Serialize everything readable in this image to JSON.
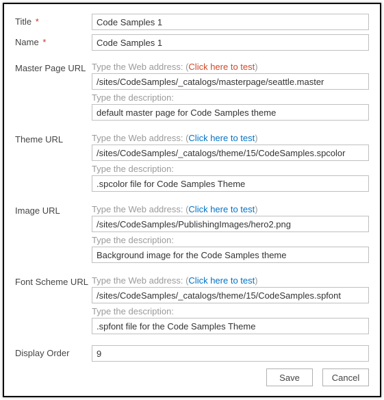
{
  "labels": {
    "title": "Title",
    "name": "Name",
    "masterPage": "Master Page URL",
    "theme": "Theme URL",
    "image": "Image URL",
    "fontScheme": "Font Scheme URL",
    "displayOrder": "Display Order",
    "required": "*"
  },
  "hints": {
    "webAddressPrefix": "Type the Web address:",
    "clickToTest": "Click here to test",
    "description": "Type the description:"
  },
  "fields": {
    "title": "Code Samples 1",
    "name": "Code Samples 1",
    "masterPage": {
      "url": "/sites/CodeSamples/_catalogs/masterpage/seattle.master",
      "desc": "default master page for Code Samples theme"
    },
    "theme": {
      "url": "/sites/CodeSamples/_catalogs/theme/15/CodeSamples.spcolor",
      "desc": ".spcolor file for Code Samples Theme"
    },
    "image": {
      "url": "/sites/CodeSamples/PublishingImages/hero2.png",
      "desc": "Background image for the Code Samples theme"
    },
    "fontScheme": {
      "url": "/sites/CodeSamples/_catalogs/theme/15/CodeSamples.spfont",
      "desc": ".spfont file for the Code Samples Theme"
    },
    "displayOrder": "9"
  },
  "buttons": {
    "save": "Save",
    "cancel": "Cancel"
  }
}
